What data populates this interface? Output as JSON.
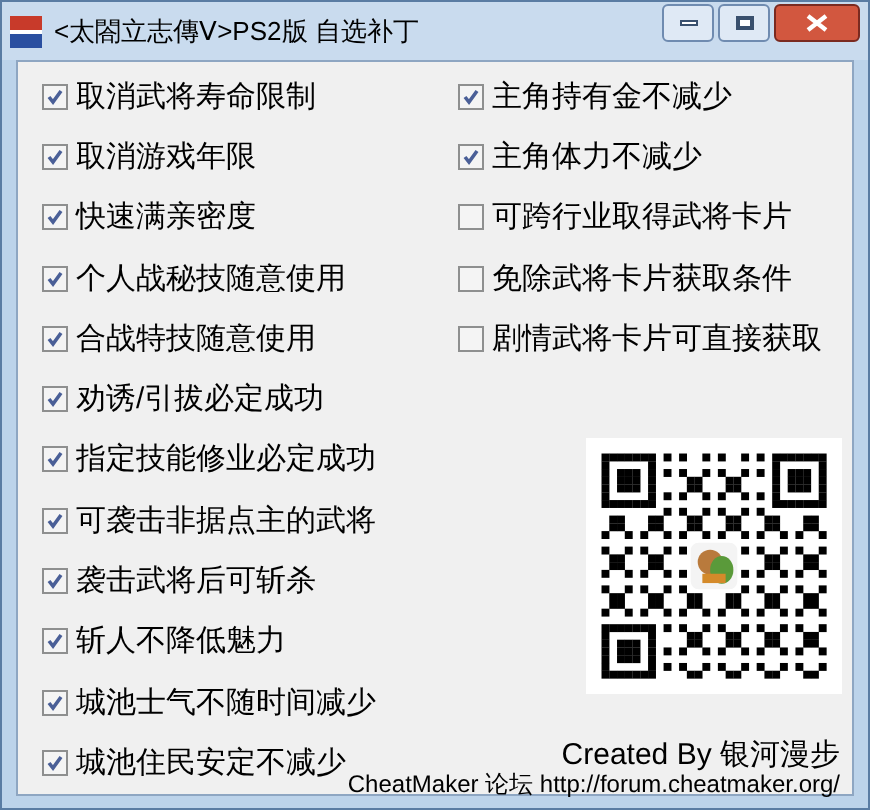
{
  "window": {
    "title": "<太閤立志傳Ⅴ>PS2版 自选补丁"
  },
  "left_options": [
    {
      "label": "取消武将寿命限制",
      "checked": true
    },
    {
      "label": "取消游戏年限",
      "checked": true
    },
    {
      "label": "快速满亲密度",
      "checked": true
    },
    {
      "label": "个人战秘技随意使用",
      "checked": true
    },
    {
      "label": "合战特技随意使用",
      "checked": true
    },
    {
      "label": "劝诱/引拔必定成功",
      "checked": true
    },
    {
      "label": "指定技能修业必定成功",
      "checked": true
    },
    {
      "label": "可袭击非据点主的武将",
      "checked": true
    },
    {
      "label": "袭击武将后可斩杀",
      "checked": true
    },
    {
      "label": "斩人不降低魅力",
      "checked": true
    },
    {
      "label": "城池士气不随时间减少",
      "checked": true
    },
    {
      "label": "城池住民安定不减少",
      "checked": true
    }
  ],
  "right_options": [
    {
      "label": "主角持有金不减少",
      "checked": true
    },
    {
      "label": "主角体力不减少",
      "checked": true
    },
    {
      "label": "可跨行业取得武将卡片",
      "checked": false
    },
    {
      "label": "免除武将卡片获取条件",
      "checked": false
    },
    {
      "label": "剧情武将卡片可直接获取",
      "checked": false
    }
  ],
  "credits": {
    "author": "Created By 银河漫步",
    "forum": "CheatMaker 论坛 http://forum.cheatmaker.org/"
  }
}
